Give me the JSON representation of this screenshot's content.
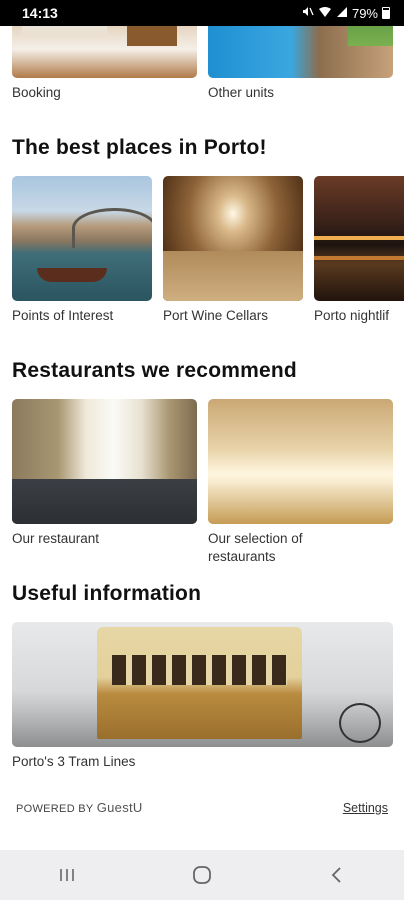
{
  "status_bar": {
    "time": "14:13",
    "battery": "79%"
  },
  "units": [
    {
      "label": "Booking"
    },
    {
      "label": "Other units"
    }
  ],
  "best_places": {
    "title": "The best places in Porto!",
    "items": [
      {
        "label": "Points of Interest"
      },
      {
        "label": "Port Wine Cellars"
      },
      {
        "label": "Porto nightlif"
      }
    ]
  },
  "restaurants": {
    "title": "Restaurants we recommend",
    "items": [
      {
        "label": "Our restaurant"
      },
      {
        "label": "Our selection of restaurants"
      }
    ]
  },
  "useful_info": {
    "title": "Useful information",
    "items": [
      {
        "label": "Porto's 3 Tram Lines"
      }
    ]
  },
  "footer": {
    "powered_by": "POWERED BY",
    "brand": "GuestU",
    "settings": "Settings"
  },
  "icons": {
    "nav_recent": "recent-apps-icon",
    "nav_home": "home-icon",
    "nav_back": "back-icon"
  }
}
